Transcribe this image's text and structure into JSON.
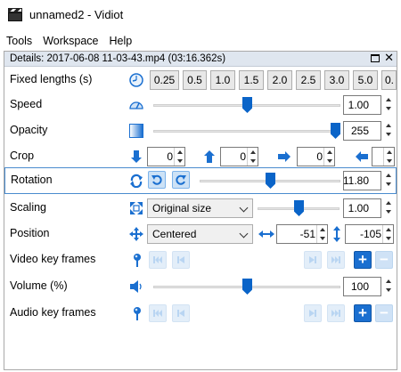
{
  "window": {
    "title": "unnamed2 - Vidiot"
  },
  "menu": [
    "Tools",
    "Workspace",
    "Help"
  ],
  "panel": {
    "header": "Details: 2017-06-08 11-03-43.mp4 (03:16.362s)"
  },
  "rows": {
    "fixed_lengths": {
      "label": "Fixed lengths (s)",
      "buttons": [
        "0.25",
        "0.5",
        "1.0",
        "1.5",
        "2.0",
        "2.5",
        "3.0",
        "5.0",
        "0."
      ]
    },
    "speed": {
      "label": "Speed",
      "value": "1.00",
      "slider_fraction": 0.5
    },
    "opacity": {
      "label": "Opacity",
      "value": "255",
      "slider_fraction": 1.0
    },
    "crop": {
      "label": "Crop",
      "top": "0",
      "bottom": "0",
      "right": "0"
    },
    "rotation": {
      "label": "Rotation",
      "value": "11.80",
      "slider_fraction": 0.5
    },
    "scaling": {
      "label": "Scaling",
      "option": "Original size",
      "value": "1.00",
      "slider_fraction": 0.5
    },
    "position": {
      "label": "Position",
      "option": "Centered",
      "x": "-51",
      "y": "-105"
    },
    "video_key_frames": {
      "label": "Video key frames"
    },
    "volume": {
      "label": "Volume (%)",
      "value": "100",
      "slider_fraction": 0.5
    },
    "audio_key_frames": {
      "label": "Audio key frames"
    }
  },
  "icons": {
    "app": "clapperboard-icon",
    "speed": "speedometer-icon",
    "opacity": "gradient-icon",
    "rotation": "rotate-icon",
    "scaling": "scale-arrows-icon",
    "position": "move-arrows-icon",
    "keyframe": "pin-icon",
    "volume": "speaker-icon"
  },
  "colors": {
    "accent": "#0a64c8",
    "selection": "#4a8ccf",
    "header_bg": "#dfe6ef"
  }
}
